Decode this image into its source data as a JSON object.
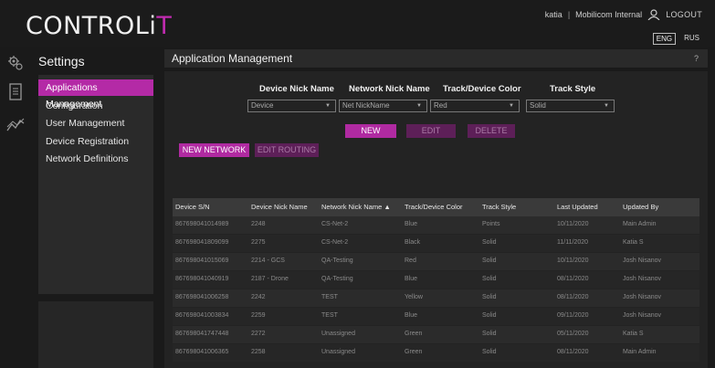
{
  "header": {
    "logo_main": "CONTROLi",
    "logo_accent": "T",
    "username": "katia",
    "separator": "|",
    "organization": "Mobilicom Internal",
    "logout_label": "LOGOUT",
    "languages": [
      "ENG",
      "RUS"
    ],
    "active_language": "ENG"
  },
  "sidebar": {
    "title": "Settings",
    "items": [
      {
        "label": "Applications Management",
        "active": true
      },
      {
        "label": "Configuration",
        "active": false
      },
      {
        "label": "User Management",
        "active": false
      },
      {
        "label": "Device Registration",
        "active": false
      },
      {
        "label": "Network Definitions",
        "active": false
      }
    ]
  },
  "main": {
    "title": "Application Management",
    "help": "?",
    "filters": {
      "device_label": "Device Nick Name",
      "device_value": "Device",
      "network_label": "Network Nick Name",
      "network_value": "Net NickName",
      "color_label": "Track/Device Color",
      "color_value": "Red",
      "style_label": "Track Style",
      "style_value": "Solid"
    },
    "buttons": {
      "new": "NEW",
      "edit": "EDIT",
      "delete": "DELETE",
      "new_network": "NEW NETWORK",
      "edit_routing": "EDIT ROUTING"
    },
    "table": {
      "columns": [
        "Device S/N",
        "Device Nick Name",
        "Network Nick Name ▲",
        "Track/Device Color",
        "Track Style",
        "Last Updated",
        "Updated By"
      ],
      "rows": [
        [
          "867698041014989",
          "2248",
          "CS-Net-2",
          "Blue",
          "Points",
          "10/11/2020",
          "Main Admin"
        ],
        [
          "867698041809099",
          "2275",
          "CS-Net-2",
          "Black",
          "Solid",
          "11/11/2020",
          "Katia S"
        ],
        [
          "867698041015069",
          "2214 - GCS",
          "QA-Testing",
          "Red",
          "Solid",
          "10/11/2020",
          "Josh Nisanov"
        ],
        [
          "867698041040919",
          "2187 - Drone",
          "QA-Testing",
          "Blue",
          "Solid",
          "08/11/2020",
          "Josh Nisanov"
        ],
        [
          "867698041006258",
          "2242",
          "TEST",
          "Yellow",
          "Solid",
          "08/11/2020",
          "Josh Nisanov"
        ],
        [
          "867698041003834",
          "2259",
          "TEST",
          "Blue",
          "Solid",
          "09/11/2020",
          "Josh Nisanov"
        ],
        [
          "867698041747448",
          "2272",
          "Unassigned",
          "Green",
          "Solid",
          "05/11/2020",
          "Katia S"
        ],
        [
          "867698041006365",
          "2258",
          "Unassigned",
          "Green",
          "Solid",
          "08/11/2020",
          "Main Admin"
        ]
      ]
    }
  },
  "colors": {
    "accent": "#b42aa6",
    "accent_disabled": "#5d1f58",
    "background": "#1a1a1a",
    "panel": "#2a2a2a"
  },
  "icons": {
    "rail": [
      "gears-icon",
      "document-icon",
      "chart-line-icon"
    ],
    "user": "user-icon"
  }
}
